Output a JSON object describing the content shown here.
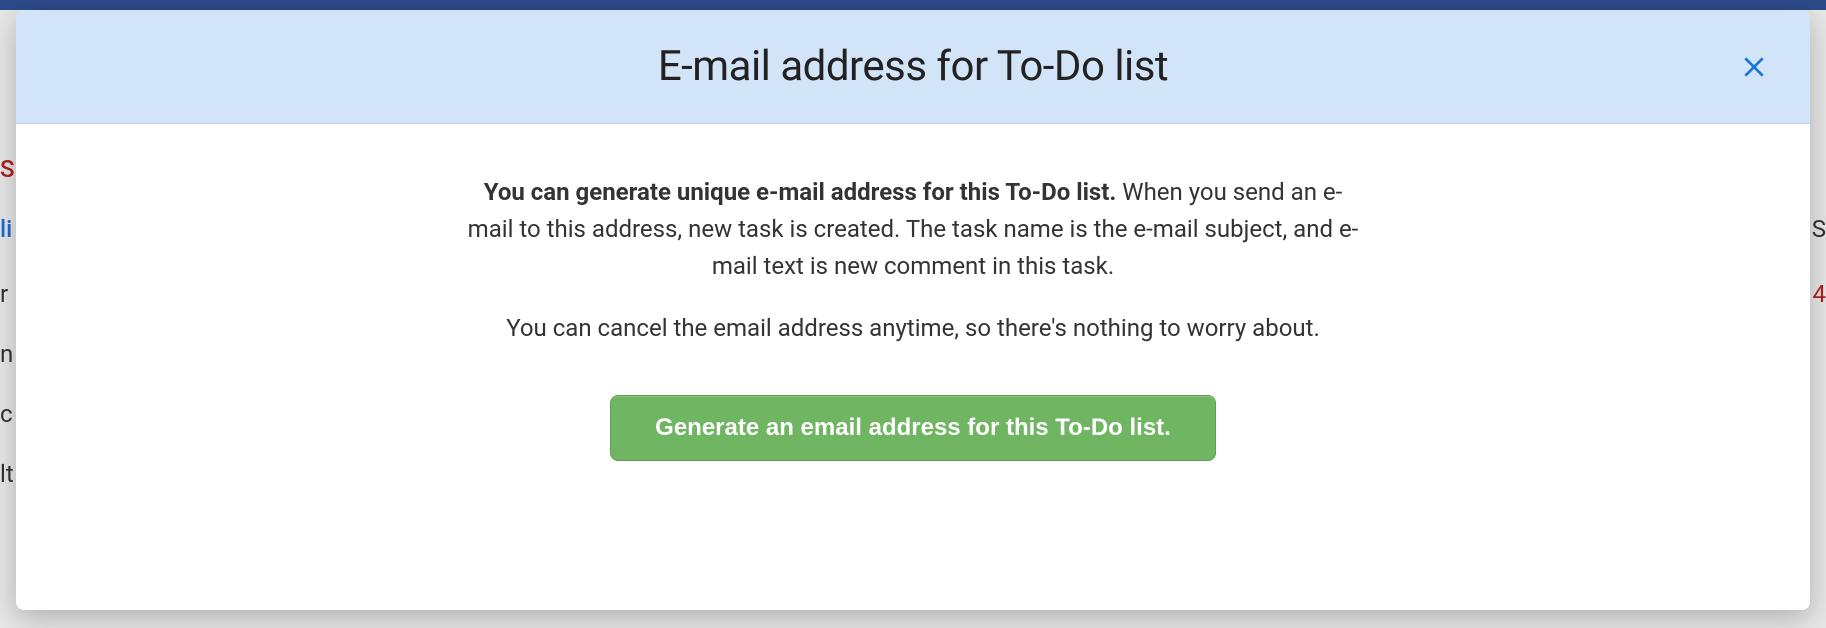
{
  "modal": {
    "title": "E-mail address for To-Do list",
    "description_bold": "You can generate unique e-mail address for this To-Do list.",
    "description_rest": " When you send an e-mail to this address, new task is created. The task name is the e-mail subject, and e-mail text is new comment in this task.",
    "description_line2": "You can cancel the email address anytime, so there's nothing to worry about.",
    "generate_button_label": "Generate an email address for this To-Do list."
  },
  "background": {
    "frag_s": "S",
    "frag_li": "li",
    "frag_r": "r",
    "frag_n": "n",
    "frag_c": "c",
    "frag_lt": "lt",
    "frag_right": "S",
    "frag_4": "4"
  }
}
